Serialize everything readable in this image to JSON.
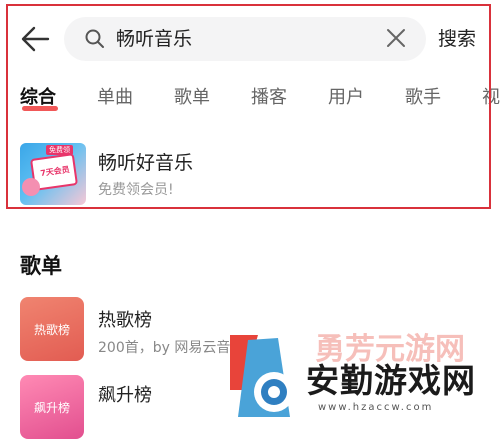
{
  "header": {
    "search_query": "畅听音乐",
    "search_button": "搜索"
  },
  "tabs": [
    "综合",
    "单曲",
    "歌单",
    "播客",
    "用户",
    "歌手",
    "视"
  ],
  "promo": {
    "title": "畅听好音乐",
    "subtitle": "免费领会员!",
    "badge": "免费领",
    "card_text": "7天会员"
  },
  "section": {
    "title": "歌单"
  },
  "playlists": [
    {
      "cover_text": "热歌榜",
      "title": "热歌榜",
      "subtitle": "200首，by 网易云音"
    },
    {
      "cover_text": "飙升榜",
      "title": "飙升榜"
    }
  ],
  "watermark": {
    "text": "安勤游戏网",
    "ghost_text": "勇芳元游网",
    "url": "www.hzaccw.com"
  },
  "colors": {
    "accent": "#ef3b3b",
    "highlight_border": "#d9313b"
  }
}
